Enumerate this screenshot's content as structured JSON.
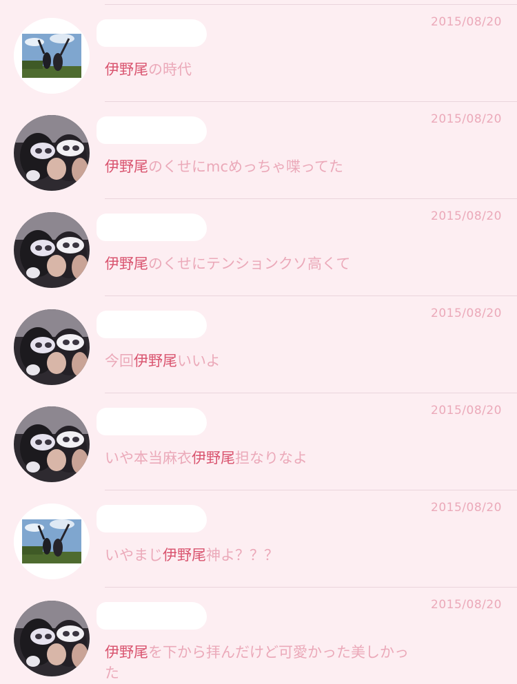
{
  "colors": {
    "background": "#fdeef2",
    "date_text": "#eba9b9",
    "body_text": "#eba9b9",
    "highlight_text": "#d9546f",
    "divider": "#ead4dc"
  },
  "tweets": [
    {
      "avatar": "photo-two-people-outdoors",
      "date": "2015/08/20",
      "segments": [
        {
          "text": "伊野尾",
          "hl": true
        },
        {
          "text": "の時代",
          "hl": false
        }
      ]
    },
    {
      "avatar": "photo-masks-selfie",
      "date": "2015/08/20",
      "segments": [
        {
          "text": "伊野尾",
          "hl": true
        },
        {
          "text": "のくせにmcめっちゃ喋ってた",
          "hl": false
        }
      ]
    },
    {
      "avatar": "photo-masks-selfie",
      "date": "2015/08/20",
      "segments": [
        {
          "text": "伊野尾",
          "hl": true
        },
        {
          "text": "のくせにテンションクソ高くて",
          "hl": false
        }
      ]
    },
    {
      "avatar": "photo-masks-selfie",
      "date": "2015/08/20",
      "segments": [
        {
          "text": "今回",
          "hl": false
        },
        {
          "text": "伊野尾",
          "hl": true
        },
        {
          "text": "いいよ",
          "hl": false
        }
      ]
    },
    {
      "avatar": "photo-masks-selfie",
      "date": "2015/08/20",
      "segments": [
        {
          "text": "いや本当麻衣",
          "hl": false
        },
        {
          "text": "伊野尾",
          "hl": true
        },
        {
          "text": "担なりなよ",
          "hl": false
        }
      ]
    },
    {
      "avatar": "photo-two-people-outdoors",
      "date": "2015/08/20",
      "segments": [
        {
          "text": "いやまじ",
          "hl": false
        },
        {
          "text": "伊野尾",
          "hl": true
        },
        {
          "text": "神よ？？？",
          "hl": false
        }
      ]
    },
    {
      "avatar": "photo-masks-selfie",
      "date": "2015/08/20",
      "segments": [
        {
          "text": "伊野尾",
          "hl": true
        },
        {
          "text": "を下から拝んだけど可愛かった美しかった",
          "hl": false
        }
      ]
    }
  ]
}
